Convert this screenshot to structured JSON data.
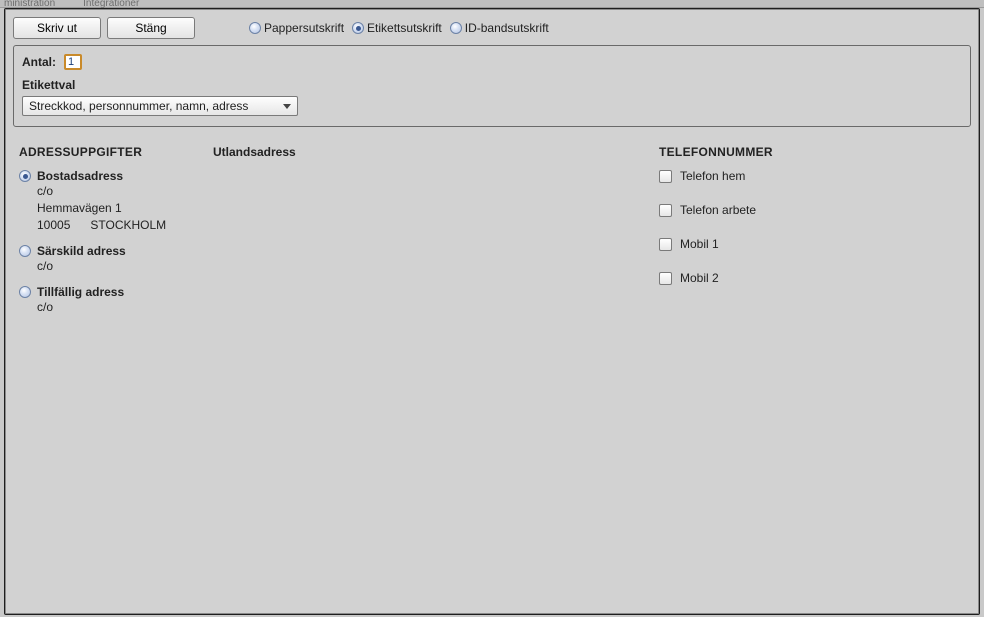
{
  "background_menu": [
    "ministration",
    "Integrationer"
  ],
  "buttons": {
    "print": "Skriv ut",
    "close": "Stäng"
  },
  "print_types": {
    "paper": "Pappersutskrift",
    "label": "Etikettsutskrift",
    "idband": "ID-bandsutskrift",
    "selected": "label"
  },
  "config": {
    "antal_label": "Antal:",
    "antal_value": "1",
    "etikettval_label": "Etikettval",
    "etikettval_selected": "Streckkod, personnummer, namn, adress"
  },
  "sections": {
    "addresses": "ADRESSUPPGIFTER",
    "foreign": "Utlandsadress",
    "phones": "TELEFONNUMMER"
  },
  "addresses": {
    "selected": "bostad",
    "bostad": {
      "title": "Bostadsadress",
      "co": "c/o",
      "street": "Hemmavägen 1",
      "postal": "10005",
      "city": "STOCKHOLM"
    },
    "sarskild": {
      "title": "Särskild adress",
      "co": "c/o"
    },
    "tillfallig": {
      "title": "Tillfällig adress",
      "co": "c/o"
    }
  },
  "phones": [
    {
      "label": "Telefon hem",
      "checked": false
    },
    {
      "label": "Telefon arbete",
      "checked": false
    },
    {
      "label": "Mobil 1",
      "checked": false
    },
    {
      "label": "Mobil 2",
      "checked": false
    }
  ]
}
